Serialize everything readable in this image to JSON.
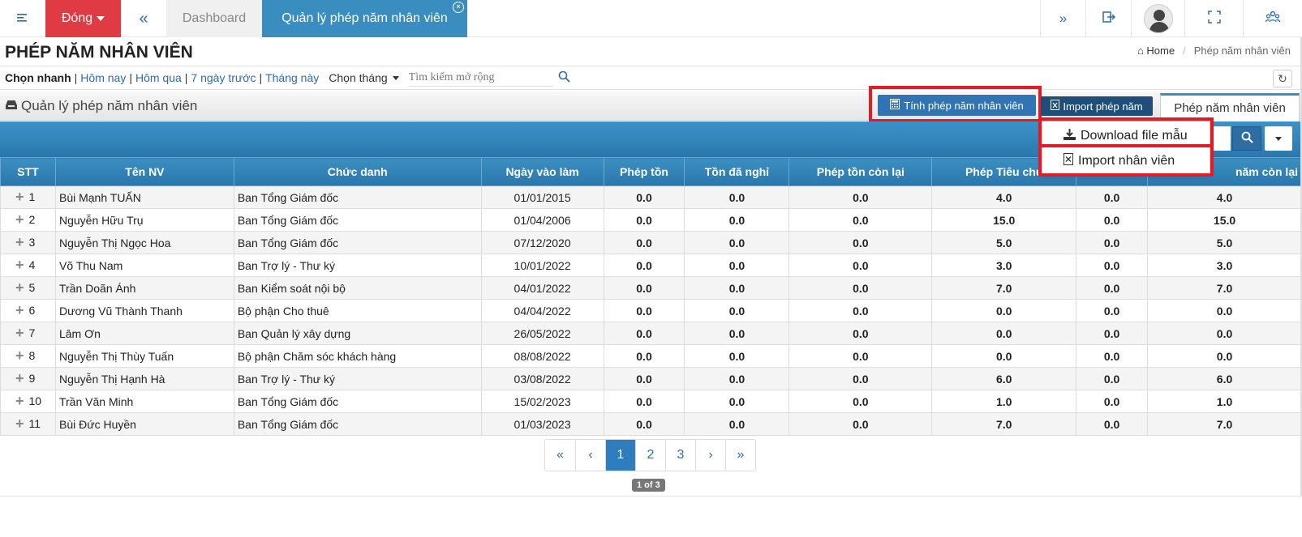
{
  "topbar": {
    "close_label": "Đóng",
    "tabs": [
      {
        "label": "Dashboard"
      },
      {
        "label": "Quản lý phép năm nhân viên"
      }
    ]
  },
  "page": {
    "title": "PHÉP NĂM NHÂN VIÊN",
    "breadcrumb": {
      "home": "Home",
      "current": "Phép năm nhân viên"
    }
  },
  "filter": {
    "quick_label": "Chọn nhanh",
    "options": [
      "Hôm nay",
      "Hôm qua",
      "7 ngày trước",
      "Tháng này"
    ],
    "month_label": "Chọn tháng",
    "search_placeholder": "Tìm kiếm mở rộng"
  },
  "panel": {
    "title": "Quản lý phép năm nhân viên",
    "calc_button": "Tính phép năm nhân viên",
    "import_button": "Import phép năm",
    "tab_label": "Phép năm nhân viên"
  },
  "dropdown": {
    "items": [
      "Download file mẫu",
      "Import nhân viên"
    ]
  },
  "table": {
    "headers": [
      "STT",
      "Tên NV",
      "Chức danh",
      "Ngày vào làm",
      "Phép tồn",
      "Tồn đã nghỉ",
      "Phép tồn còn lại",
      "Phép Tiêu chu",
      "",
      "năm còn lại"
    ],
    "rows": [
      {
        "stt": "1",
        "name": "Bùi Mạnh TUẤN",
        "title": "Ban Tổng Giám đốc",
        "date": "01/01/2015",
        "v1": "0.0",
        "v2": "0.0",
        "v3": "0.0",
        "v4": "4.0",
        "v5": "0.0",
        "v6": "4.0"
      },
      {
        "stt": "2",
        "name": "Nguyễn Hữu Trụ",
        "title": "Ban Tổng Giám đốc",
        "date": "01/04/2006",
        "v1": "0.0",
        "v2": "0.0",
        "v3": "0.0",
        "v4": "15.0",
        "v5": "0.0",
        "v6": "15.0"
      },
      {
        "stt": "3",
        "name": "Nguyễn Thị Ngọc Hoa",
        "title": "Ban Tổng Giám đốc",
        "date": "07/12/2020",
        "v1": "0.0",
        "v2": "0.0",
        "v3": "0.0",
        "v4": "5.0",
        "v5": "0.0",
        "v6": "5.0"
      },
      {
        "stt": "4",
        "name": "Võ Thu Nam",
        "title": "Ban Trợ lý - Thư ký",
        "date": "10/01/2022",
        "v1": "0.0",
        "v2": "0.0",
        "v3": "0.0",
        "v4": "3.0",
        "v5": "0.0",
        "v6": "3.0"
      },
      {
        "stt": "5",
        "name": "Trần Doãn Ánh",
        "title": "Ban Kiểm soát nội bộ",
        "date": "04/01/2022",
        "v1": "0.0",
        "v2": "0.0",
        "v3": "0.0",
        "v4": "7.0",
        "v5": "0.0",
        "v6": "7.0"
      },
      {
        "stt": "6",
        "name": "Dương Vũ Thành Thanh",
        "title": "Bộ phận Cho thuê",
        "date": "04/04/2022",
        "v1": "0.0",
        "v2": "0.0",
        "v3": "0.0",
        "v4": "0.0",
        "v5": "0.0",
        "v6": "0.0"
      },
      {
        "stt": "7",
        "name": "Lâm Ơn",
        "title": "Ban Quản lý xây dựng",
        "date": "26/05/2022",
        "v1": "0.0",
        "v2": "0.0",
        "v3": "0.0",
        "v4": "0.0",
        "v5": "0.0",
        "v6": "0.0"
      },
      {
        "stt": "8",
        "name": "Nguyễn Thị Thùy Tuấn",
        "title": "Bộ phận Chăm sóc khách hàng",
        "date": "08/08/2022",
        "v1": "0.0",
        "v2": "0.0",
        "v3": "0.0",
        "v4": "0.0",
        "v5": "0.0",
        "v6": "0.0"
      },
      {
        "stt": "9",
        "name": "Nguyễn Thị Hạnh Hà",
        "title": "Ban Trợ lý - Thư ký",
        "date": "03/08/2022",
        "v1": "0.0",
        "v2": "0.0",
        "v3": "0.0",
        "v4": "6.0",
        "v5": "0.0",
        "v6": "6.0"
      },
      {
        "stt": "10",
        "name": "Trần Văn Minh",
        "title": "Ban Tổng Giám đốc",
        "date": "15/02/2023",
        "v1": "0.0",
        "v2": "0.0",
        "v3": "0.0",
        "v4": "1.0",
        "v5": "0.0",
        "v6": "1.0"
      },
      {
        "stt": "11",
        "name": "Bùi Đức Huyền",
        "title": "Ban Tổng Giám đốc",
        "date": "01/03/2023",
        "v1": "0.0",
        "v2": "0.0",
        "v3": "0.0",
        "v4": "7.0",
        "v5": "0.0",
        "v6": "7.0"
      }
    ]
  },
  "pagination": {
    "first": "«",
    "prev": "‹",
    "pages": [
      "1",
      "2",
      "3"
    ],
    "next": "›",
    "last": "»",
    "summary": "1 of 3"
  },
  "colors": {
    "accent": "#3a8ebf",
    "close_red": "#e03a45",
    "highlight_red": "#e21b24",
    "header_blue": "#2a77ad"
  }
}
